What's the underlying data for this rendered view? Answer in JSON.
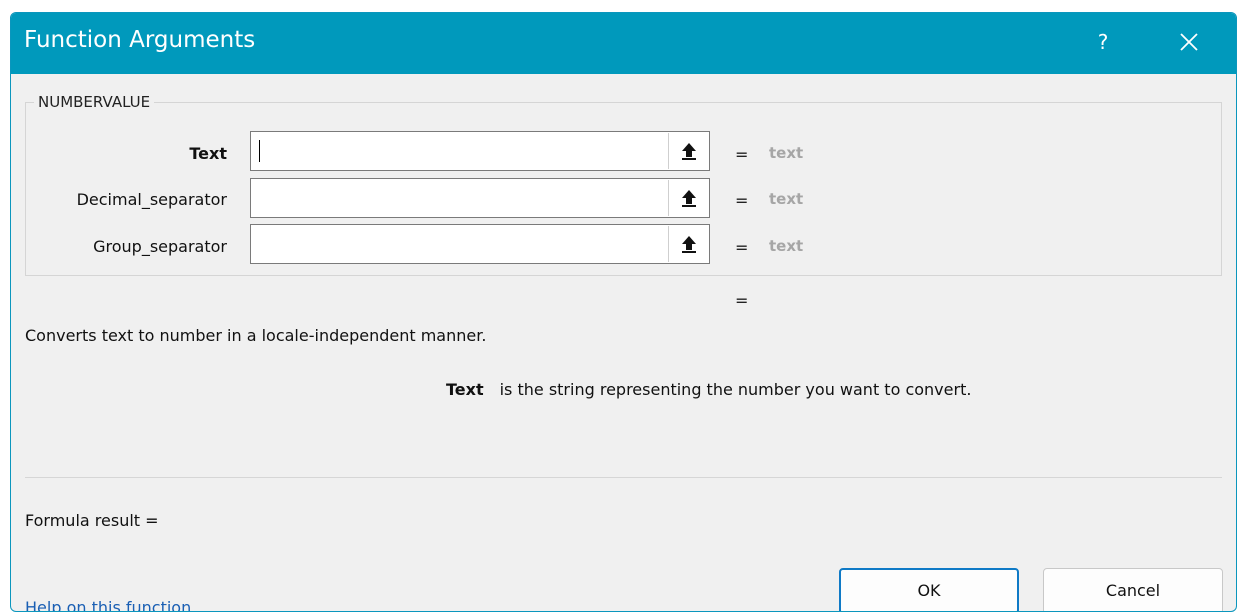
{
  "window": {
    "title": "Function Arguments",
    "help_glyph": "?",
    "close_icon": "close-icon"
  },
  "function_group": {
    "name": "NUMBERVALUE",
    "arguments": [
      {
        "label": "Text",
        "value": "",
        "result": "text"
      },
      {
        "label": "Decimal_separator",
        "value": "",
        "result": "text"
      },
      {
        "label": "Group_separator",
        "value": "",
        "result": "text"
      }
    ],
    "equals": "="
  },
  "function_result_equals": "=",
  "description": "Converts text to number in a locale-independent manner.",
  "argument_help": {
    "name": "Text",
    "text": "is the string representing the number you want to convert."
  },
  "formula_result": "Formula result =",
  "help_link": "Help on this function",
  "buttons": {
    "ok": "OK",
    "cancel": "Cancel"
  },
  "colors": {
    "titlebar": "#0099bc",
    "link": "#1a5fb4",
    "ok_border": "#0f7ac6",
    "placeholder_value": "#a6a6a6"
  }
}
